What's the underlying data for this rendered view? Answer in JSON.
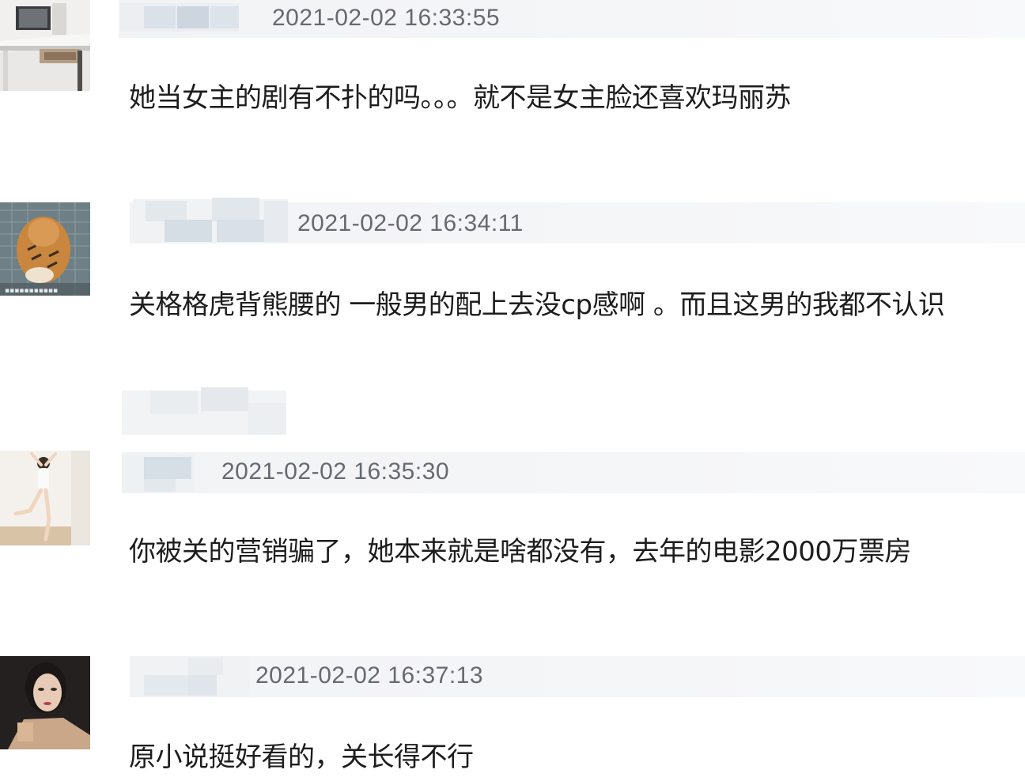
{
  "comments": [
    {
      "timestamp": "2021-02-02 16:33:55",
      "text": "她当女主的剧有不扑的吗。。。就不是女主脸还喜欢玛丽苏",
      "avatar_icon": "desk-photo-avatar"
    },
    {
      "timestamp": "2021-02-02 16:34:11",
      "text": "关格格虎背熊腰的 一般男的配上去没cp感啊 。而且这男的我都不认识",
      "avatar_icon": "tiger-photo-avatar"
    },
    {
      "timestamp": "2021-02-02 16:35:30",
      "text": "你被关的营销骗了，她本来就是啥都没有，去年的电影2000万票房",
      "avatar_icon": "dancer-photo-avatar"
    },
    {
      "timestamp": "2021-02-02 16:37:13",
      "text": "原小说挺好看的，关长得不行",
      "avatar_icon": "woman-portrait-avatar"
    }
  ],
  "colors": {
    "header_bg": "#f3f4f6",
    "timestamp": "#666a70",
    "text": "#1d1d1d"
  }
}
